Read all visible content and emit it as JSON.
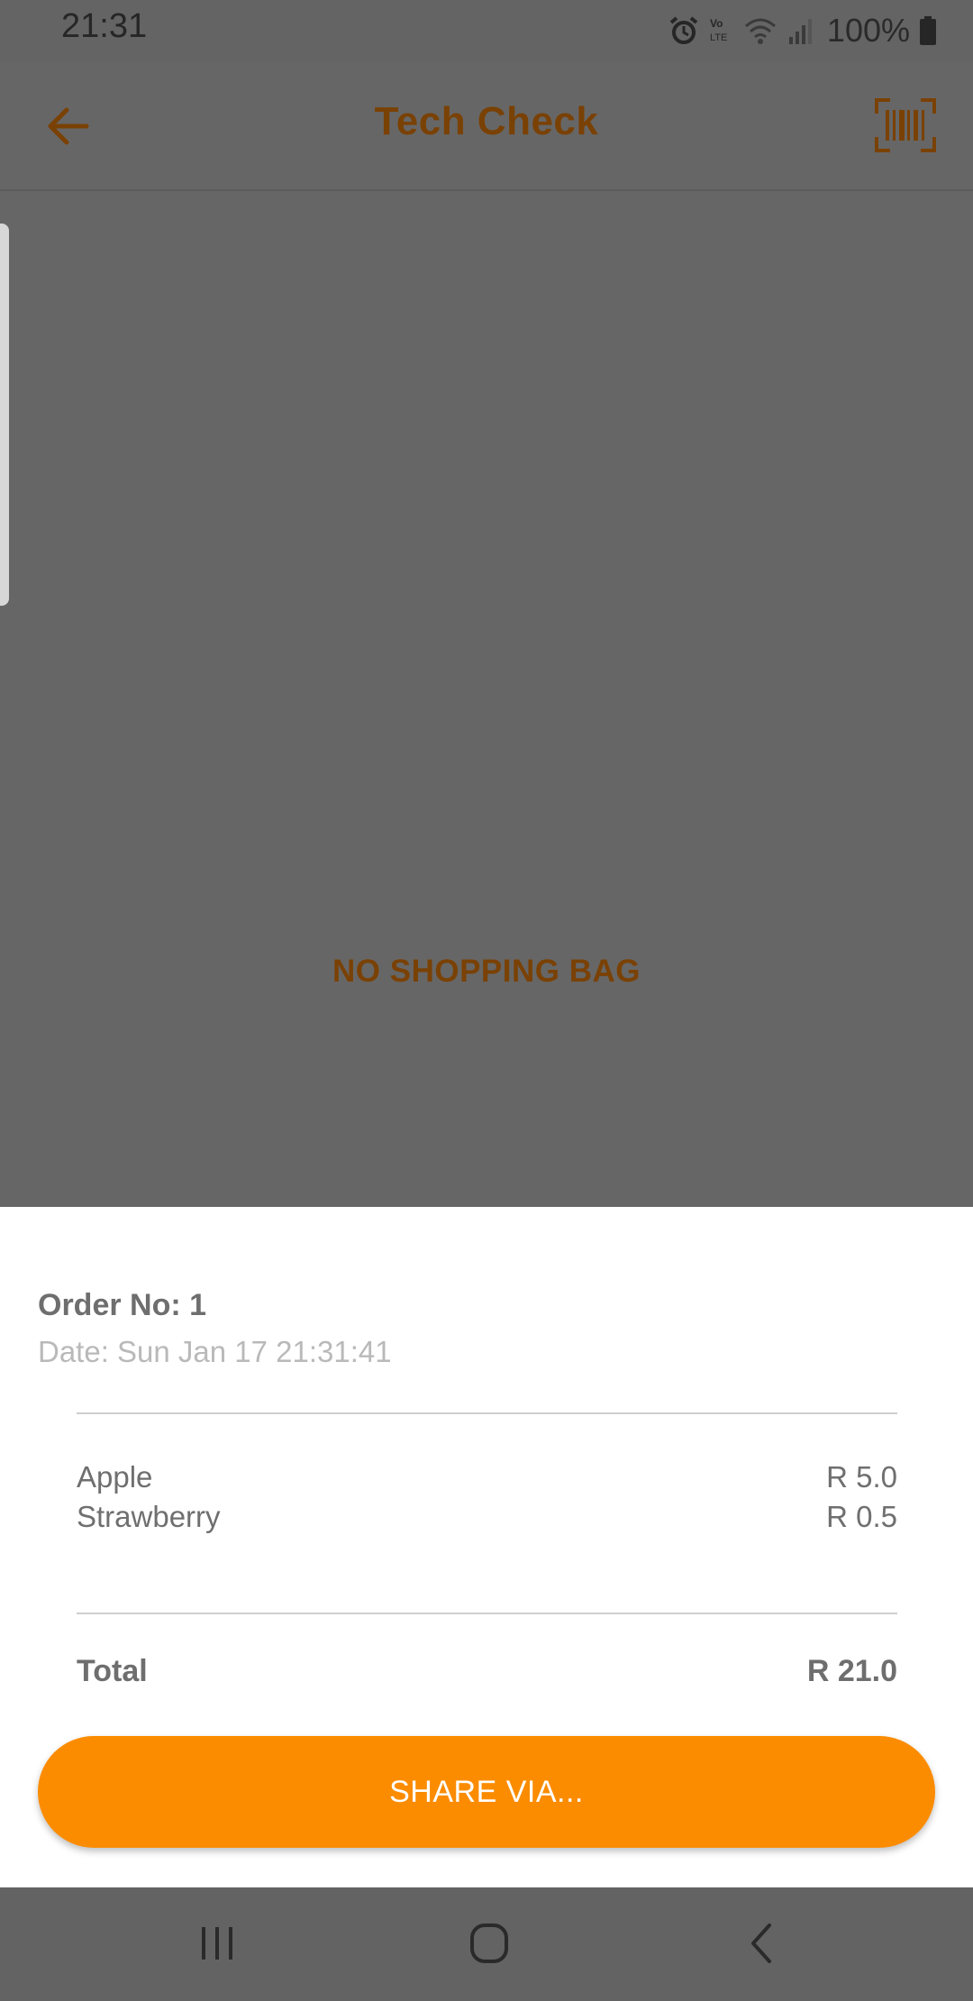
{
  "status_bar": {
    "time": "21:31",
    "battery": "100%",
    "icons": [
      "alarm-icon",
      "volte-icon",
      "wifi-icon",
      "signal-icon",
      "battery-icon"
    ]
  },
  "app_bar": {
    "title": "Tech Check",
    "back_icon": "arrow-left-icon",
    "scan_icon": "barcode-scan-icon",
    "accent_color": "#7a4104"
  },
  "main": {
    "empty_message": "NO SHOPPING BAG"
  },
  "order": {
    "order_no": "Order No: 1",
    "date": "Date: Sun Jan 17 21:31:41",
    "items": [
      {
        "name": "Apple",
        "price": "R 5.0"
      },
      {
        "name": "Strawberry",
        "price": "R 0.5"
      }
    ],
    "total_label": "Total",
    "total_value": "R 21.0",
    "share_label": "SHARE VIA...",
    "share_color": "#fb8c00"
  },
  "nav_bar": {
    "icons": [
      "recent-apps-icon",
      "home-icon",
      "back-nav-icon"
    ]
  }
}
